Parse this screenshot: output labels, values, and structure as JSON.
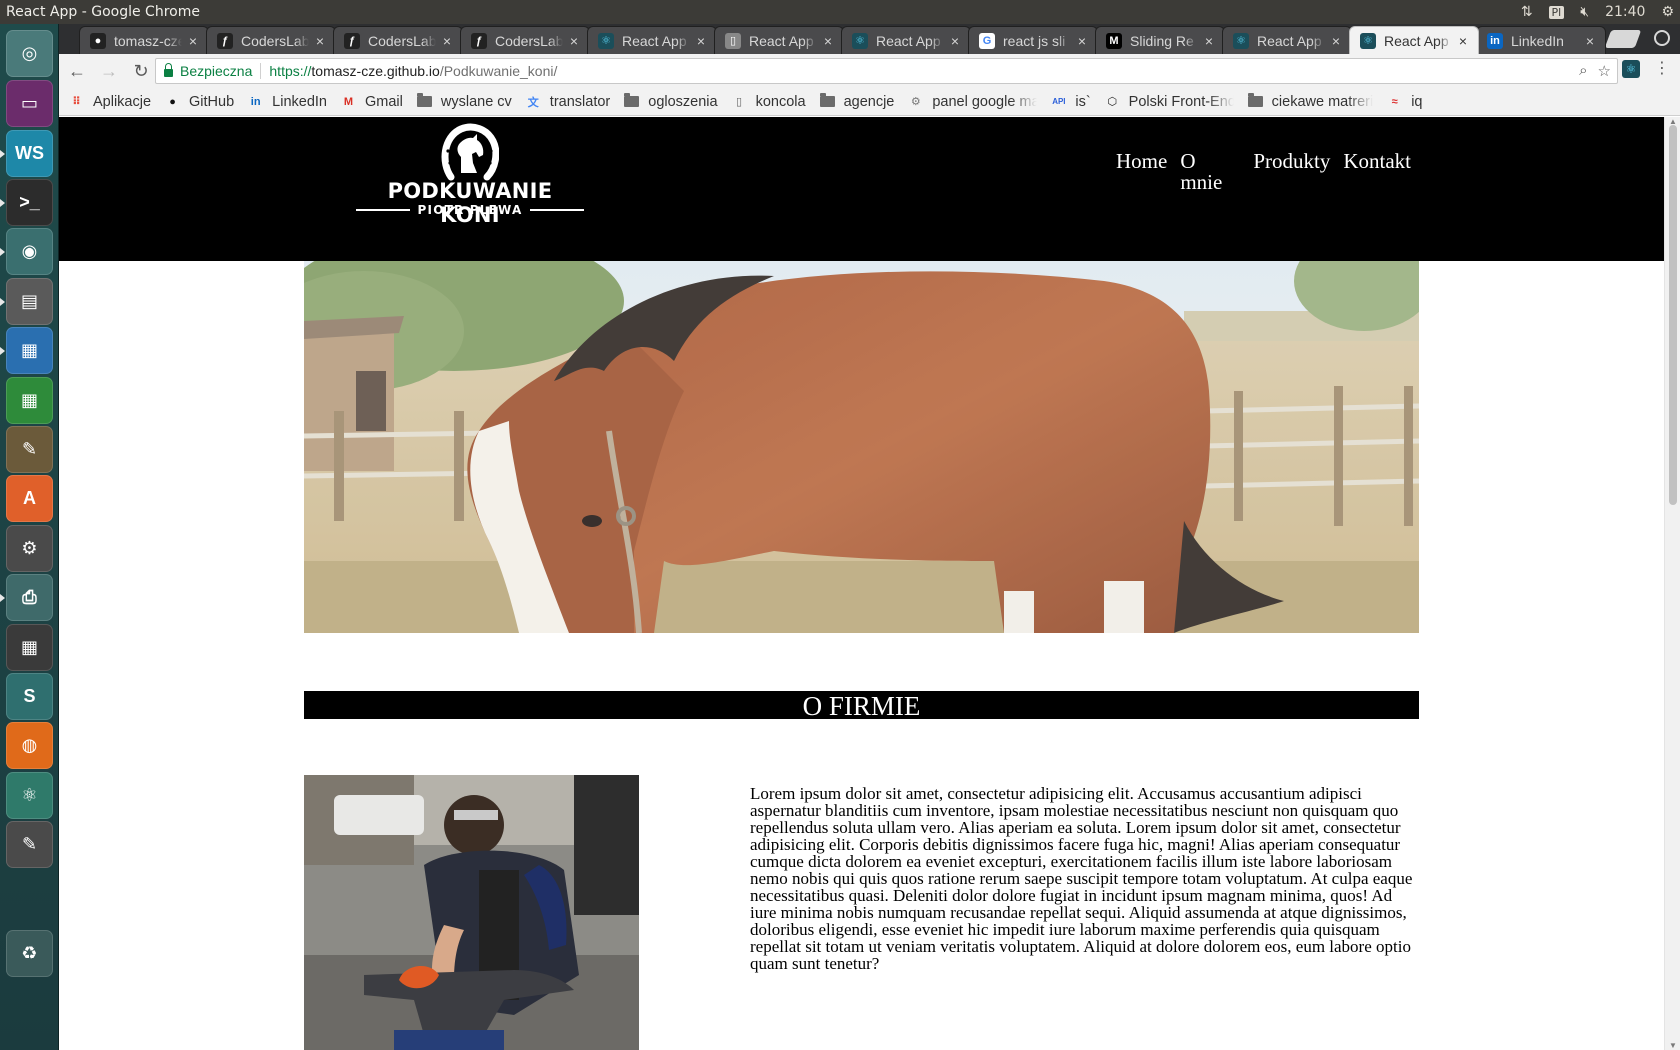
{
  "os": {
    "window_title": "React App - Google Chrome",
    "keyboard_layout": "Pl",
    "clock": "21:40"
  },
  "launcher": {
    "apps": [
      {
        "icon": "ubuntu-dash-icon",
        "color": "#4a7a7a"
      },
      {
        "icon": "workspace-icon",
        "color": "#6b2c6b"
      },
      {
        "icon": "webstorm-icon",
        "color": "#1e88a8"
      },
      {
        "icon": "terminal-icon",
        "color": "#2c2c2c"
      },
      {
        "icon": "chrome-icon",
        "color": "#3a6f6f"
      },
      {
        "icon": "files-icon",
        "color": "#5a5a5a"
      },
      {
        "icon": "writer-icon",
        "color": "#2a6fb0"
      },
      {
        "icon": "calc-icon",
        "color": "#2e8b3a"
      },
      {
        "icon": "gimp-icon",
        "color": "#6b5a3a"
      },
      {
        "icon": "software-center-icon",
        "color": "#e0602a"
      },
      {
        "icon": "settings-icon",
        "color": "#4a4a4a"
      },
      {
        "icon": "scanner-icon",
        "color": "#3f6a6a"
      },
      {
        "icon": "calculator-icon",
        "color": "#3a3a3a"
      },
      {
        "icon": "slack-icon",
        "color": "#2f6f6f"
      },
      {
        "icon": "firefox-icon",
        "color": "#e06a1a"
      },
      {
        "icon": "atom-icon",
        "color": "#2f7a6a"
      },
      {
        "icon": "text-editor-icon",
        "color": "#4a4a4a"
      },
      {
        "icon": "trash-icon",
        "color": "#3a5a5a"
      }
    ]
  },
  "tabs": [
    {
      "label": "tomasz-cze",
      "favicon": "github-icon",
      "fav_color": "#222",
      "active": false
    },
    {
      "label": "CodersLab",
      "favicon": "coderslab-icon",
      "fav_color": "#222",
      "active": false
    },
    {
      "label": "CodersLab",
      "favicon": "coderslab-icon",
      "fav_color": "#222",
      "active": false
    },
    {
      "label": "CodersLab",
      "favicon": "coderslab-icon",
      "fav_color": "#222",
      "active": false
    },
    {
      "label": "React App",
      "favicon": "react-icon",
      "fav_color": "#1b4e5a",
      "active": false
    },
    {
      "label": "React App",
      "favicon": "page-icon",
      "fav_color": "#888",
      "active": false
    },
    {
      "label": "React App",
      "favicon": "react-icon",
      "fav_color": "#1b4e5a",
      "active": false
    },
    {
      "label": "react js sli",
      "favicon": "google-icon",
      "fav_color": "#fff",
      "active": false
    },
    {
      "label": "Sliding Re",
      "favicon": "medium-icon",
      "fav_color": "#000",
      "active": false
    },
    {
      "label": "React App",
      "favicon": "react-icon",
      "fav_color": "#1b4e5a",
      "active": false
    },
    {
      "label": "React App",
      "favicon": "react-icon",
      "fav_color": "#1b4e5a",
      "active": true
    },
    {
      "label": "LinkedIn",
      "favicon": "linkedin-icon",
      "fav_color": "#0a66c2",
      "active": false
    }
  ],
  "toolbar": {
    "back": "←",
    "forward": "→",
    "reload": "↻",
    "secure_label": "Bezpieczna",
    "url_scheme": "https://",
    "url_host": "tomasz-cze.github.io",
    "url_path": "/Podkuwanie_koni/",
    "zoom_icon": "⌕",
    "star_icon": "☆",
    "menu_icon": "⋮"
  },
  "bookmarks": [
    {
      "label": "Aplikacje",
      "icon": "apps-grid-icon"
    },
    {
      "label": "GitHub",
      "icon": "github-icon"
    },
    {
      "label": "LinkedIn",
      "icon": "linkedin-icon"
    },
    {
      "label": "Gmail",
      "icon": "gmail-icon"
    },
    {
      "label": "wyslane cv",
      "icon": "folder-icon"
    },
    {
      "label": "translator",
      "icon": "translate-icon"
    },
    {
      "label": "ogloszenia",
      "icon": "folder-icon"
    },
    {
      "label": "koncola",
      "icon": "page-icon"
    },
    {
      "label": "agencje",
      "icon": "folder-icon"
    },
    {
      "label": "panel google ma",
      "icon": "gear-icon"
    },
    {
      "label": "is`",
      "icon": "api-icon"
    },
    {
      "label": "Polski Front-End",
      "icon": "hexagon-icon"
    },
    {
      "label": "ciekawe matreri",
      "icon": "folder-icon"
    },
    {
      "label": "iq",
      "icon": "flag-icon"
    }
  ],
  "site": {
    "logo_title": "PODKUWANIE KONI",
    "logo_subtitle": "PIOTR PLEWA",
    "nav": [
      "Home",
      "O mnie",
      "Produkty",
      "Kontakt"
    ],
    "section_title": "O FIRMIE",
    "about_text": "Lorem ipsum dolor sit amet, consectetur adipisicing elit. Accusamus accusantium adipisci aspernatur blanditiis cum inventore, ipsam molestiae necessitatibus nesciunt non quisquam quo repellendus soluta ullam vero. Alias aperiam ea soluta. Lorem ipsum dolor sit amet, consectetur adipisicing elit. Corporis debitis dignissimos facere fuga hic, magni! Alias aperiam consequatur cumque dicta dolorem ea eveniet excepturi, exercitationem facilis illum iste labore laboriosam nemo nobis qui quis quos ratione rerum saepe suscipit tempore totam voluptatum. At culpa eaque necessitatibus quasi. Deleniti dolor dolore fugiat in incidunt ipsum magnam minima, quos! Ad iure minima nobis numquam recusandae repellat sequi. Aliquid assumenda at atque dignissimos, doloribus eligendi, esse eveniet hic impedit iure laborum maxime perferendis quia quisquam repellat sit totam ut veniam veritatis voluptatem. Aliquid at dolore dolorem eos, eum labore optio quam sunt tenetur?"
  }
}
